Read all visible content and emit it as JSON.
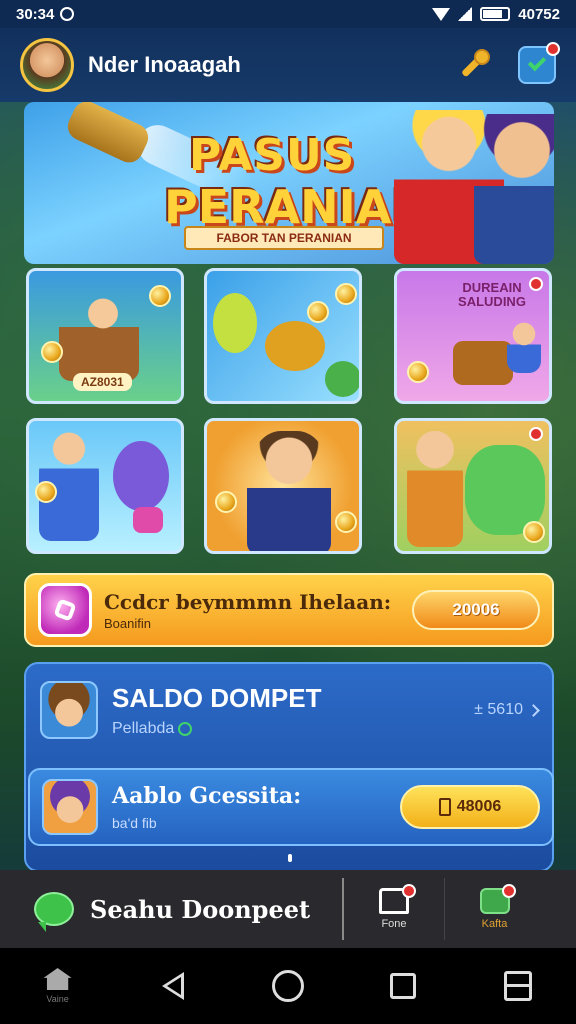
{
  "status_bar": {
    "time": "30:34",
    "battery_text": "40752"
  },
  "header": {
    "username": "Nder Inoaagah"
  },
  "banner": {
    "title_line1": "PASUS",
    "title_line2": "PERANIAN",
    "ribbon_text": "FABOR TAN PERANIAN"
  },
  "games": [
    {
      "label": "AZ8031",
      "has_badge": false
    },
    {
      "label": "",
      "has_badge": false
    },
    {
      "label": "",
      "sub_title": "DUREAIN SALUDING",
      "has_badge": true
    },
    {
      "label": "",
      "has_badge": false
    },
    {
      "label": "",
      "has_badge": false
    },
    {
      "label": "",
      "has_badge": true
    }
  ],
  "promo": {
    "title": "Ccdcr beymmmn Ihelaan:",
    "subtitle": "Boanifin",
    "amount": "20006"
  },
  "wallet": {
    "title": "SALDO DOMPET",
    "subtitle": "Pellabda",
    "value": "± 5610",
    "balance_title": "Aablo Gcessita:",
    "balance_subtitle": "ba'd fib",
    "withdraw_amount": "48006"
  },
  "app_bar": {
    "search_label": "Seahu Doonpeet",
    "tab_feed_label": "Fone",
    "tab_gift_label": "Kafta"
  },
  "nav": {
    "home_label": "Vaine"
  },
  "colors": {
    "accent": "#f5c542",
    "wallet_blue": "#2c6bc8",
    "promo_orange": "#f59a1e",
    "badge_red": "#e0312f"
  }
}
